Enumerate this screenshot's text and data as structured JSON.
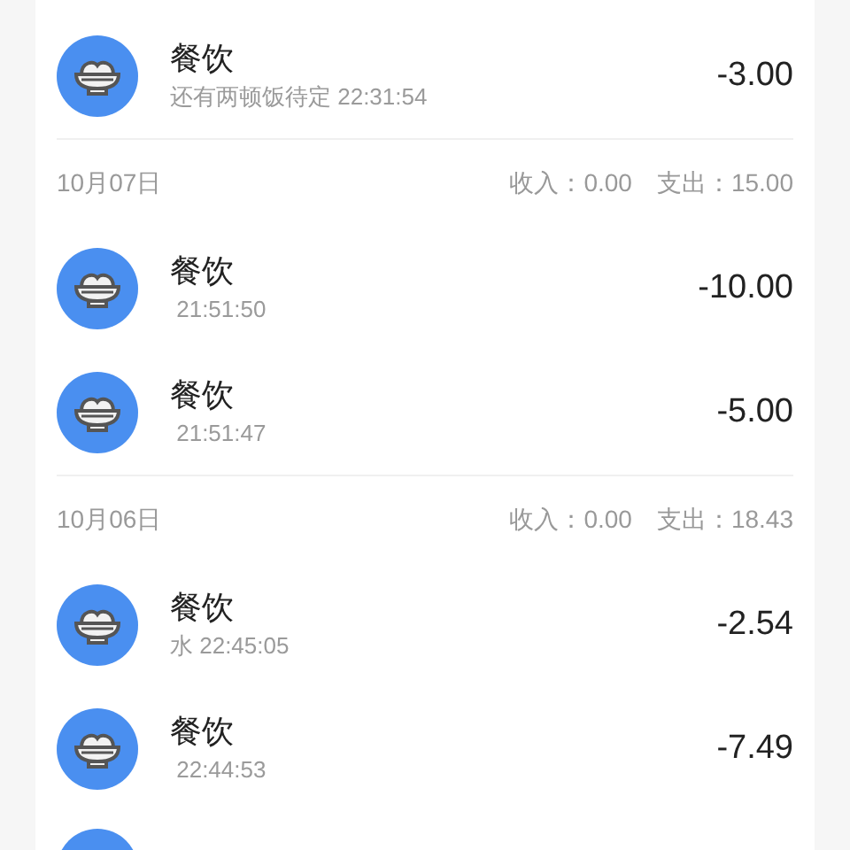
{
  "sections": [
    {
      "records": [
        {
          "category": "餐饮",
          "detail": "还有两顿饭待定 22:31:54",
          "amount": "-3.00"
        }
      ]
    },
    {
      "date": "10月07日",
      "income": "收入：0.00",
      "expense": "支出：15.00",
      "records": [
        {
          "category": "餐饮",
          "detail": " 21:51:50",
          "amount": "-10.00"
        },
        {
          "category": "餐饮",
          "detail": " 21:51:47",
          "amount": "-5.00"
        }
      ]
    },
    {
      "date": "10月06日",
      "income": "收入：0.00",
      "expense": "支出：18.43",
      "records": [
        {
          "category": "餐饮",
          "detail": "水 22:45:05",
          "amount": "-2.54"
        },
        {
          "category": "餐饮",
          "detail": " 22:44:53",
          "amount": "-7.49"
        },
        {
          "kind": "partial"
        }
      ]
    }
  ]
}
